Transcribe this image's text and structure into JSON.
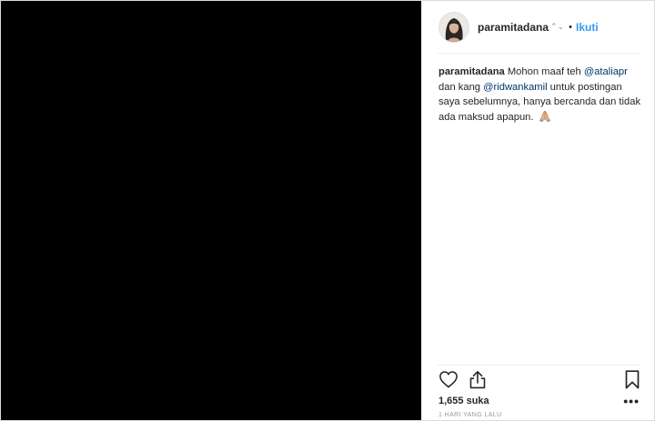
{
  "post": {
    "media": {
      "background": "#000000"
    },
    "header": {
      "username": "paramitadana",
      "separator": "•",
      "follow_label": "Ikuti",
      "badge_glyph": "⌃⌄"
    },
    "caption": {
      "username": "paramitadana",
      "text_1": "Mohon maaf teh ",
      "mention_1": "@ataliapr",
      "text_2": " dan kang ",
      "mention_2": "@ridwankamil",
      "text_3": " untuk postingan saya sebelumnya, hanya bercanda dan tidak ada maksud apapun.",
      "emoji": "praying-hands-emoji"
    },
    "actions": {
      "like_icon": "heart-icon",
      "share_icon": "share-icon",
      "save_icon": "bookmark-icon"
    },
    "likes_text": "1,655 suka",
    "more_label": "•••",
    "timestamp": "1 HARI YANG LALU"
  },
  "colors": {
    "accent": "#3897f0",
    "mention": "#003569",
    "text": "#262626",
    "muted": "#999999",
    "divider": "#efefef"
  }
}
